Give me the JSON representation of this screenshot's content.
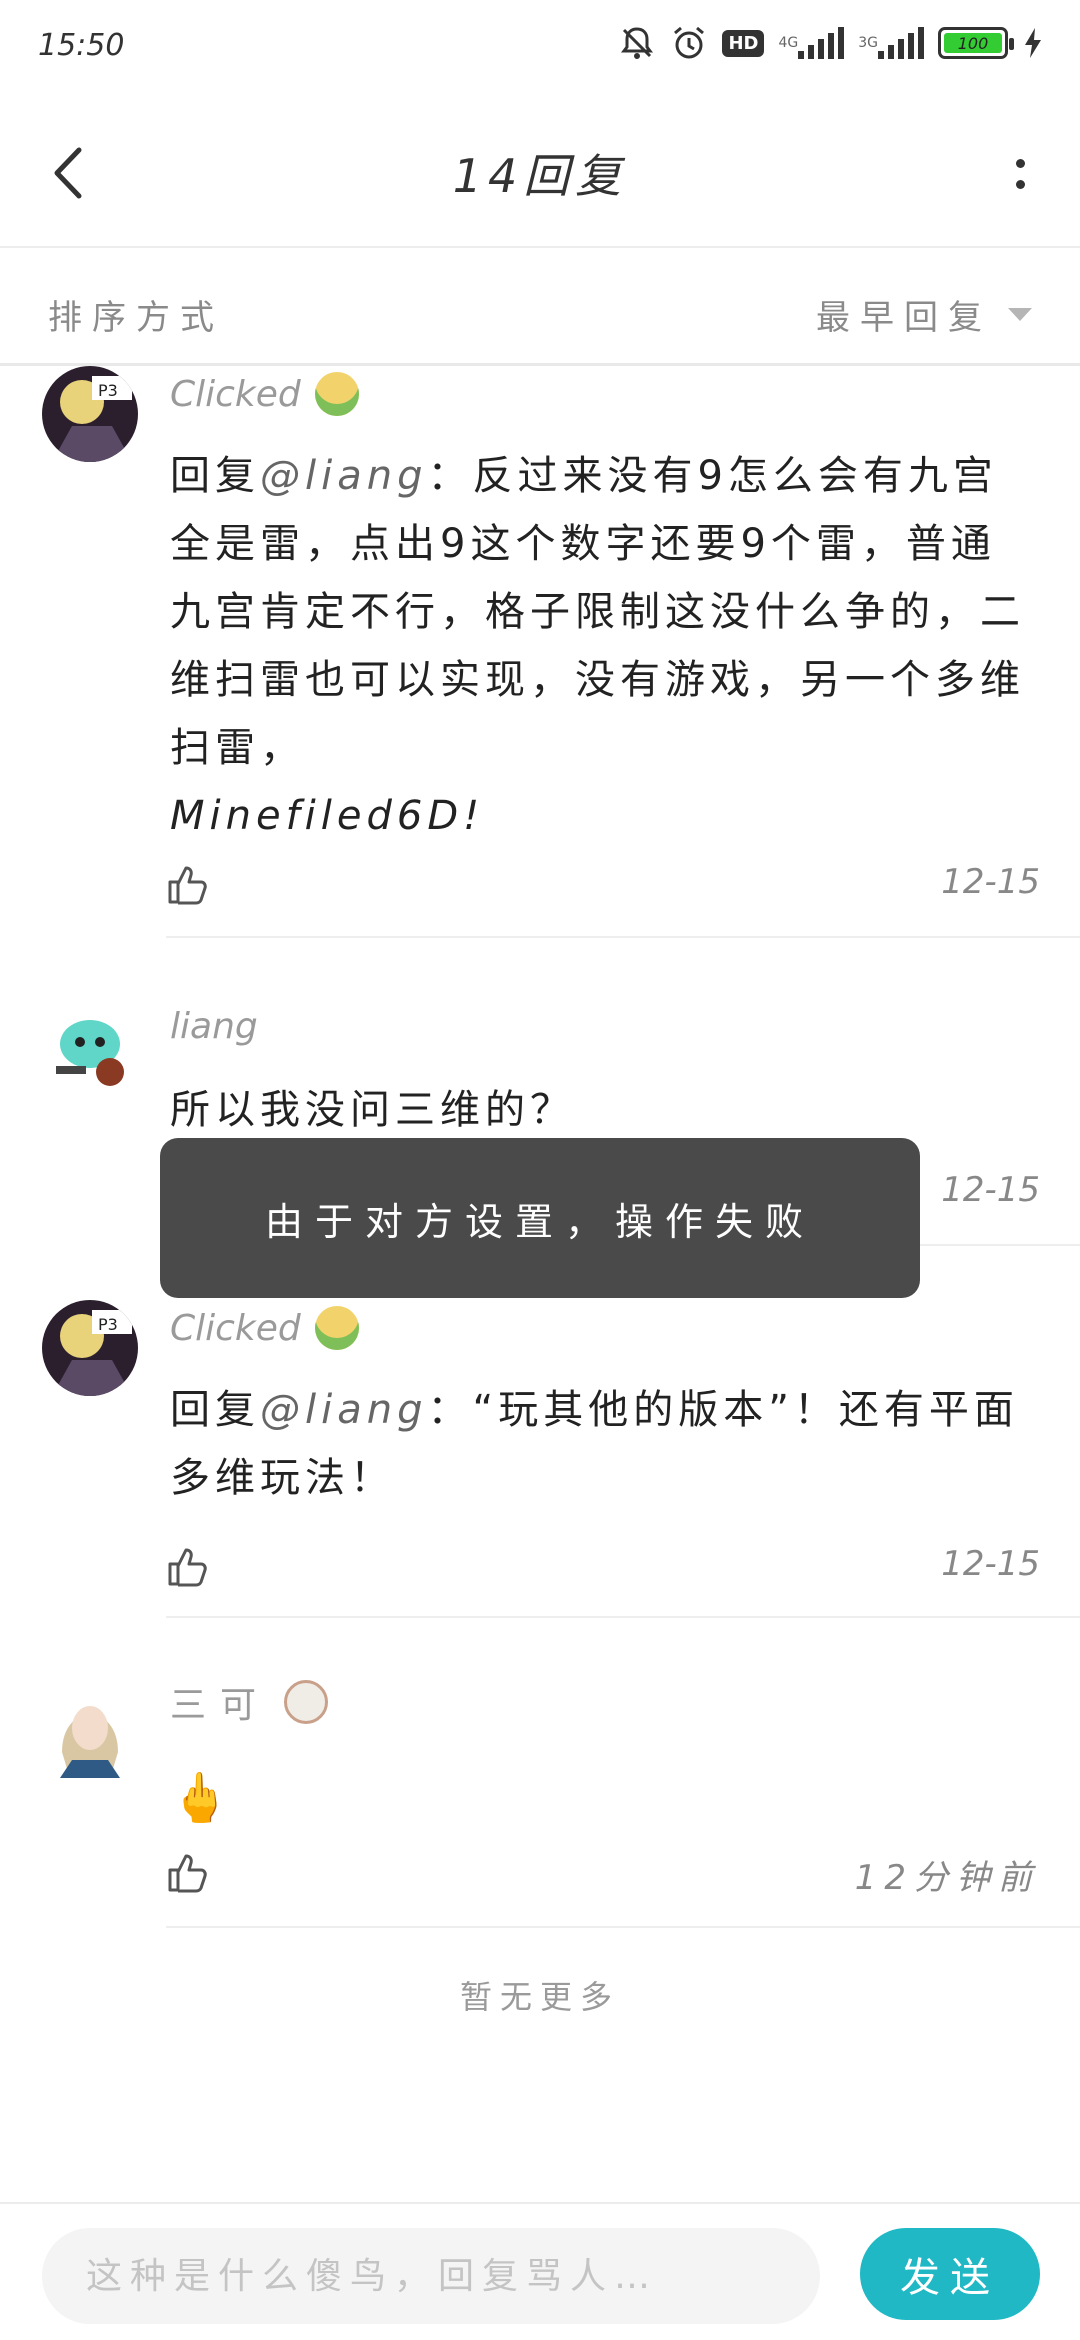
{
  "status_bar": {
    "time": "15:50",
    "net1": "4G",
    "net2": "3G",
    "hd": "HD",
    "battery": "100",
    "icons": [
      "bell-off-icon",
      "alarm-icon",
      "hd-icon",
      "signal-icon",
      "signal-icon",
      "battery-icon",
      "charging-icon"
    ]
  },
  "header": {
    "title": "14回复",
    "back_icon": "chevron-left-icon",
    "more_icon": "more-vertical-icon"
  },
  "sort": {
    "label": "排序方式",
    "value": "最早回复"
  },
  "comments": [
    {
      "author": "Clicked",
      "reply_prefix": "回复",
      "mention": "@liang",
      "text": "：反过来没有9怎么会有九宫全是雷，点出9这个数字还要9个雷，普通九宫肯定不行，格子限制这没什么争的，二维扫雷也可以实现，没有游戏，另一个多维扫雷，",
      "extra": "Minefiled6D!",
      "date": "12-15"
    },
    {
      "author": "liang",
      "text": "所以我没问三维的？",
      "date": "12-15"
    },
    {
      "author": "Clicked",
      "reply_prefix": "回复",
      "mention": "@liang",
      "text": "：“玩其他的版本”！还有平面多维玩法！",
      "date": "12-15"
    },
    {
      "author": "三可",
      "text": "🖕",
      "date": "12分钟前"
    }
  ],
  "no_more": "暂无更多",
  "toast": "由于对方设置，操作失败",
  "compose": {
    "placeholder": "这种是什么傻鸟，回复骂人…",
    "send_label": "发送"
  },
  "colors": {
    "accent": "#1fb8c4",
    "toast_bg": "#4a4a4a",
    "battery": "#33cc33"
  }
}
